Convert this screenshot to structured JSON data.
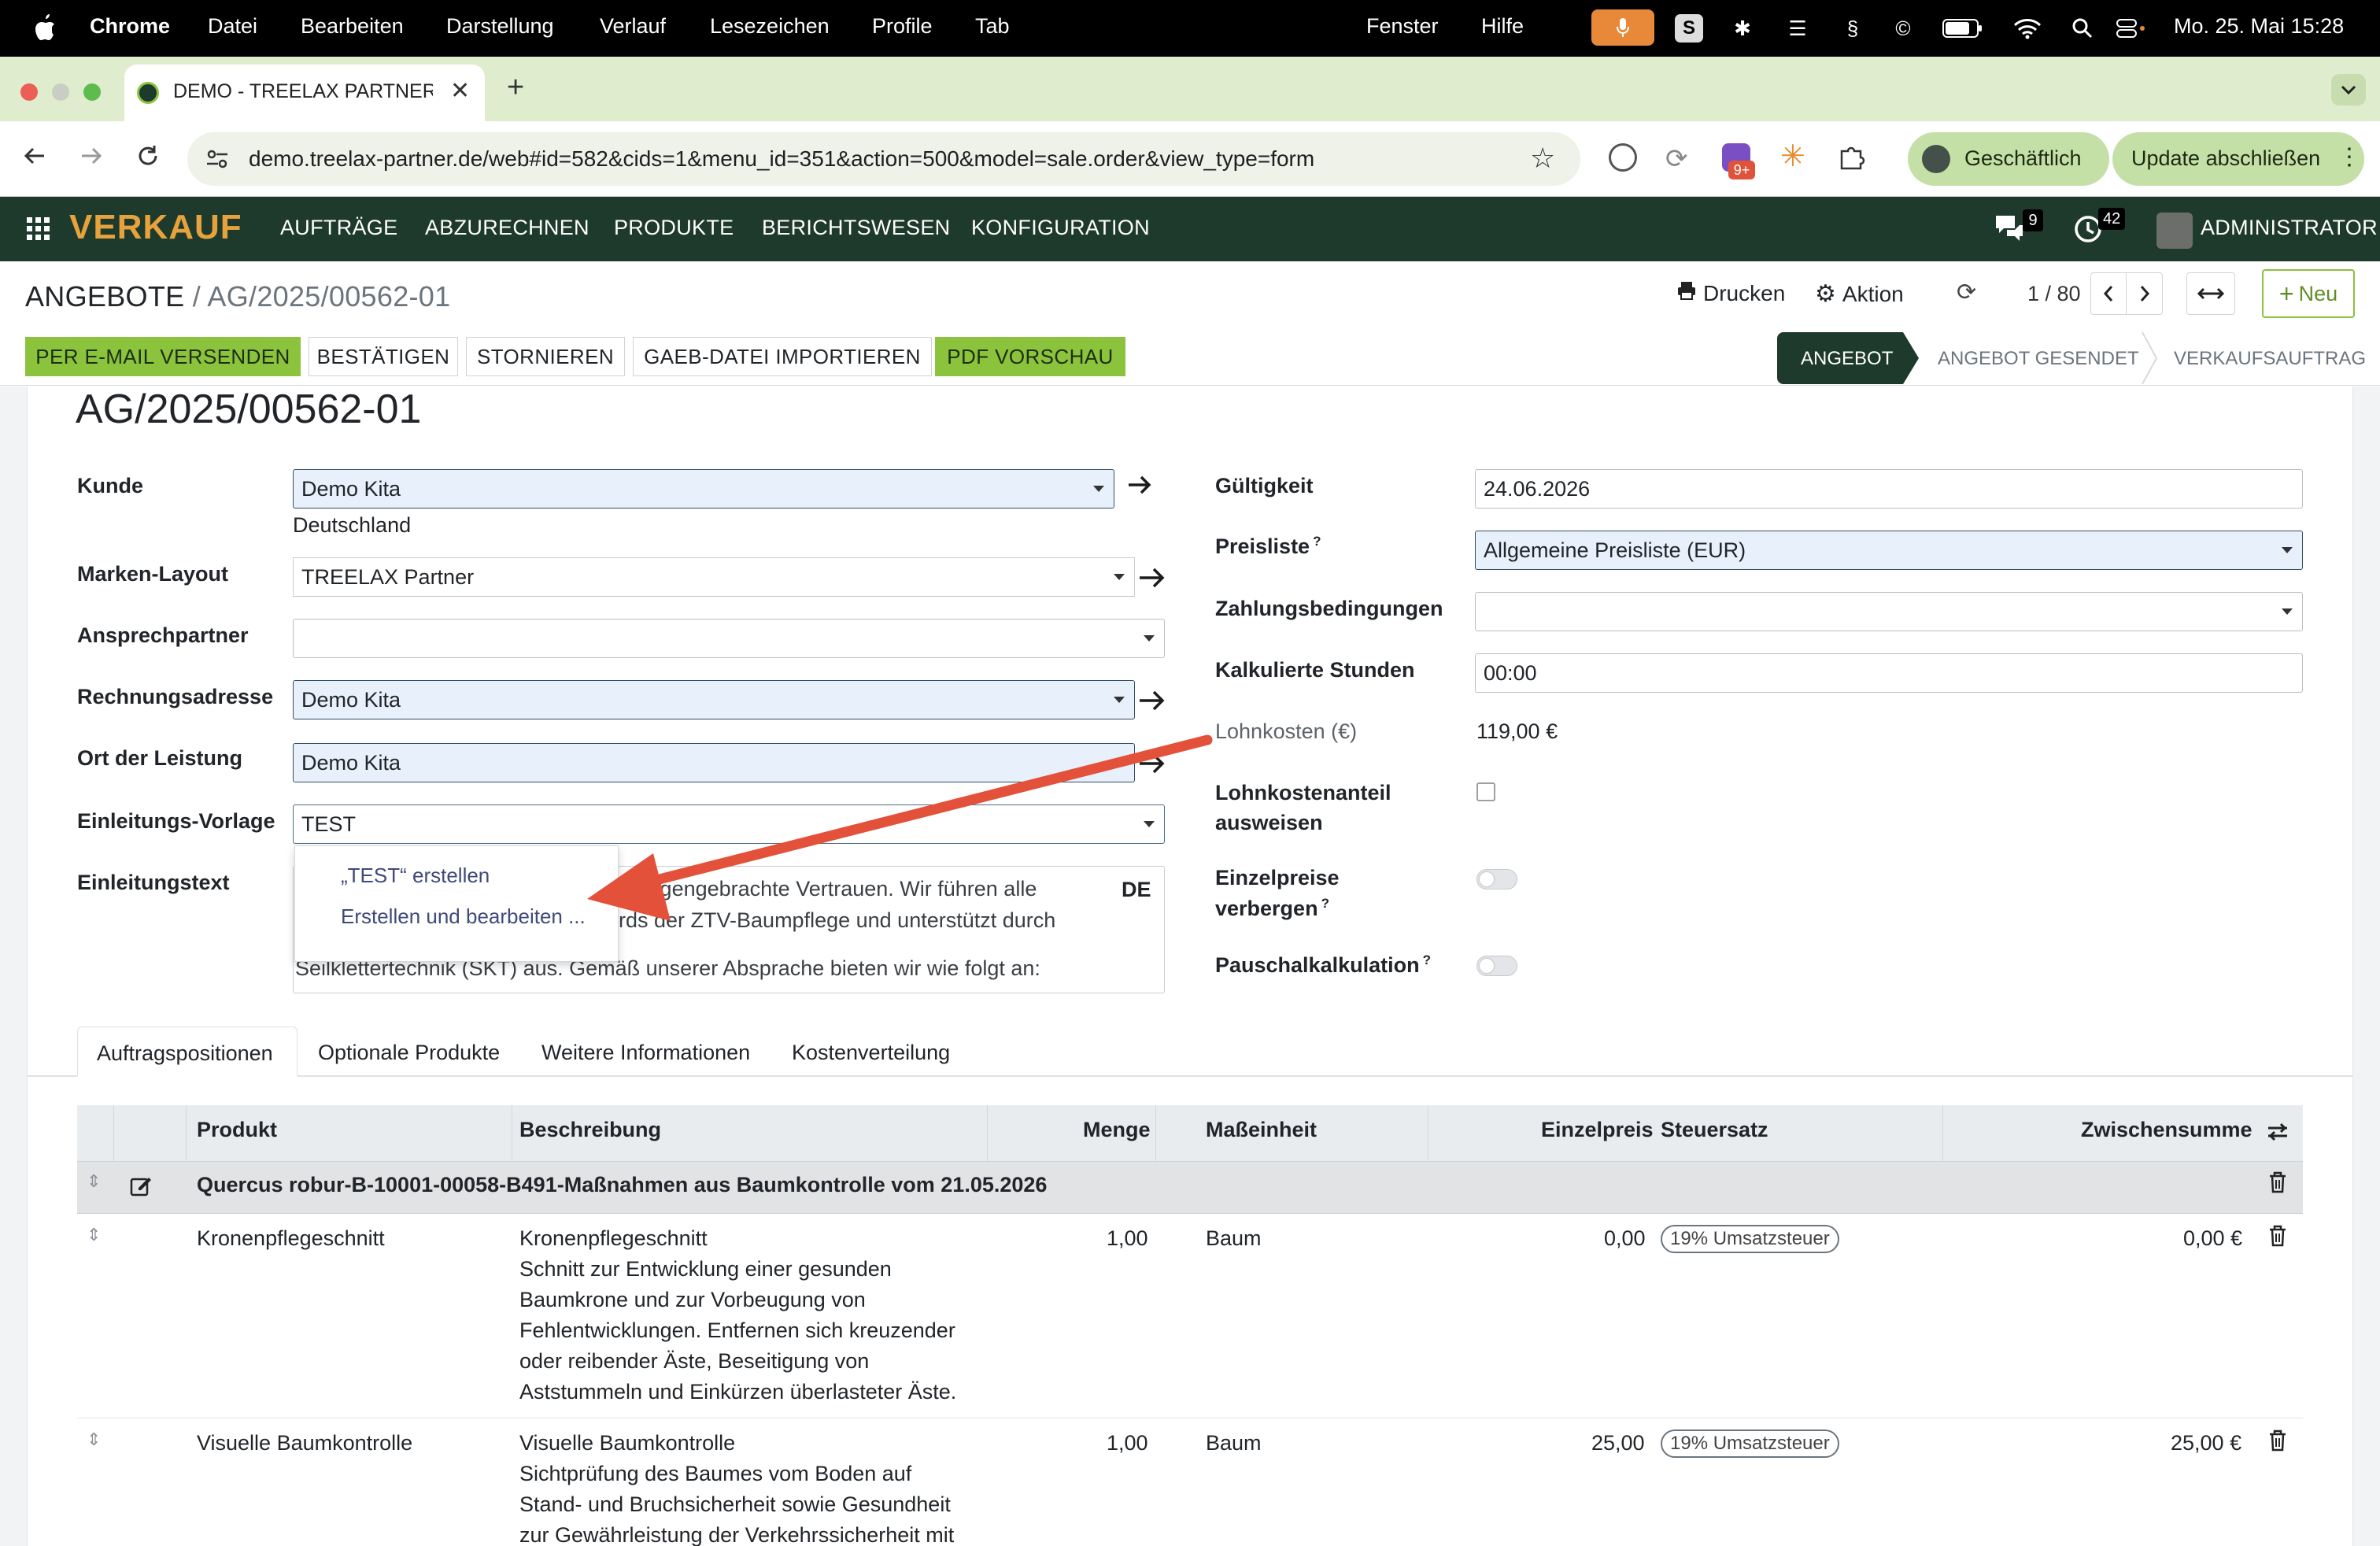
{
  "macos_menubar": {
    "apple": "",
    "app": "Chrome",
    "menus": [
      "Datei",
      "Bearbeiten",
      "Darstellung",
      "Verlauf",
      "Lesezeichen",
      "Profile",
      "Tab",
      "Fenster",
      "Hilfe"
    ],
    "clock": "Mo. 25. Mai  15:28"
  },
  "browser": {
    "tab_title": "DEMO - TREELAX PARTNER -",
    "new_tab": "+",
    "url": "demo.treelax-partner.de/web#id=582&cids=1&menu_id=351&action=500&model=sale.order&view_type=form",
    "profile": "Geschäftlich",
    "update_button": "Update abschließen",
    "ext_badge": "9+"
  },
  "app_nav": {
    "module": "VERKAUF",
    "items": [
      "AUFTRÄGE",
      "ABZURECHNEN",
      "PRODUKTE",
      "BERICHTSWESEN",
      "KONFIGURATION"
    ],
    "chat_count": "9",
    "activity_count": "42",
    "user": "ADMINISTRATOR"
  },
  "breadcrumb": {
    "parent": "ANGEBOTE",
    "separator": "/",
    "current": "AG/2025/00562-01"
  },
  "control": {
    "print": "Drucken",
    "action": "Aktion",
    "pager": "1 / 80",
    "new": "Neu"
  },
  "actions": [
    "PER E-MAIL VERSENDEN",
    "BESTÄTIGEN",
    "STORNIEREN",
    "GAEB-DATEI IMPORTIEREN",
    "PDF VORSCHAU"
  ],
  "statusbar": [
    "ANGEBOT",
    "ANGEBOT GESENDET",
    "VERKAUFSAUFTRAG"
  ],
  "record_title": "AG/2025/00562-01",
  "left_fields": {
    "kunde": {
      "label": "Kunde",
      "value": "Demo Kita",
      "sub": "Deutschland"
    },
    "marken": {
      "label": "Marken-Layout",
      "value": "TREELAX Partner"
    },
    "ansprech": {
      "label": "Ansprechpartner",
      "value": ""
    },
    "rechnung": {
      "label": "Rechnungsadresse",
      "value": "Demo Kita"
    },
    "ort": {
      "label": "Ort der Leistung",
      "value": "Demo Kita"
    },
    "vorlage": {
      "label": "Einleitungs-Vorlage",
      "value": "TEST"
    },
    "text": {
      "label": "Einleitungstext",
      "line1": "ntgegengebrachte Vertrauen. Wir führen alle",
      "line2": "rds der ZTV-Baumpflege und unterstützt durch",
      "line3": "Seilklettertechnik (SKT) aus. Gemäß unserer Absprache bieten wir wie folgt an:",
      "lang": "DE"
    }
  },
  "dropdown": [
    "„TEST“ erstellen",
    "Erstellen und bearbeiten ..."
  ],
  "right_fields": {
    "gueltigkeit": {
      "label": "Gültigkeit",
      "value": "24.06.2026"
    },
    "preisliste": {
      "label": "Preisliste",
      "help": "?",
      "value": "Allgemeine Preisliste (EUR)"
    },
    "zahlung": {
      "label": "Zahlungsbedingungen",
      "value": ""
    },
    "stunden": {
      "label": "Kalkulierte Stunden",
      "value": "00:00"
    },
    "lohnkosten": {
      "label": "Lohnkosten (€)",
      "value": "119,00 €"
    },
    "lohnanteil": {
      "label1": "Lohnkostenanteil",
      "label2": "ausweisen"
    },
    "einzelpreise": {
      "label1": "Einzelpreise",
      "label2": "verbergen",
      "help": "?"
    },
    "pauschal": {
      "label": "Pauschalkalkulation",
      "help": "?"
    }
  },
  "tabs": [
    "Auftragspositionen",
    "Optionale Produkte",
    "Weitere Informationen",
    "Kostenverteilung"
  ],
  "table": {
    "headers": [
      "Produkt",
      "Beschreibung",
      "Menge",
      "Maßeinheit",
      "Einzelpreis",
      "Steuersatz",
      "Zwischensumme"
    ],
    "section": "Quercus robur-B-10001-00058-B491-Maßnahmen aus Baumkontrolle vom 21.05.2026",
    "rows": [
      {
        "product": "Kronenpflegeschnitt",
        "desc": [
          "Kronenpflegeschnitt",
          "Schnitt zur Entwicklung einer gesunden",
          "Baumkrone und zur Vorbeugung von",
          "Fehlentwicklungen. Entfernen sich kreuzender",
          "oder reibender Äste, Beseitigung von",
          "Aststummeln und Einkürzen überlasteter Äste."
        ],
        "qty": "1,00",
        "uom": "Baum",
        "price": "0,00",
        "tax": "19% Umsatzsteuer",
        "subtotal": "0,00 €"
      },
      {
        "product": "Visuelle Baumkontrolle",
        "desc": [
          "Visuelle Baumkontrolle",
          "Sichtprüfung des Baumes vom Boden auf",
          "Stand- und Bruchsicherheit sowie Gesundheit",
          "zur Gewährleistung der Verkehrssicherheit mit"
        ],
        "qty": "1,00",
        "uom": "Baum",
        "price": "25,00",
        "tax": "19% Umsatzsteuer",
        "subtotal": "25,00 €"
      }
    ]
  },
  "colors": {
    "navbar": "#1e3a2c",
    "module": "#e6a23c",
    "green_button": "#8bc33c",
    "annotation_arrow": "#e3513a",
    "statusbar_active": "#1e3a2c"
  }
}
